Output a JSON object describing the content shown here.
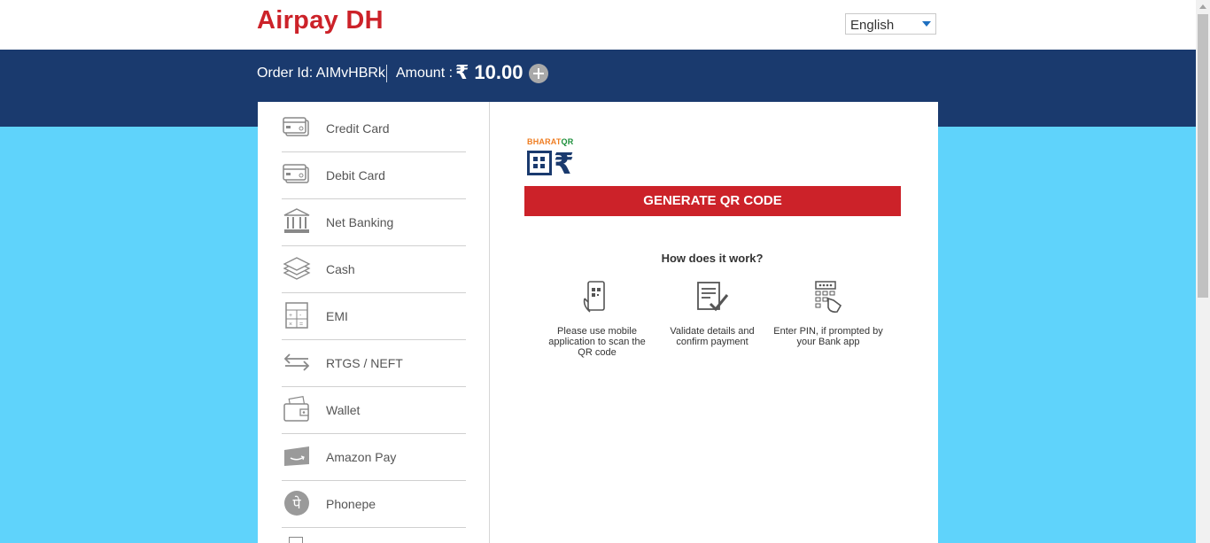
{
  "header": {
    "brand": "Airpay DH",
    "language": {
      "selected": "English"
    }
  },
  "order": {
    "order_id_text": "Order Id: AIMvHBRk",
    "amount_label": "Amount :",
    "amount_value": "₹ 10.00"
  },
  "sidebar": {
    "items": [
      {
        "label": "Credit Card",
        "icon": "credit-card-icon"
      },
      {
        "label": "Debit Card",
        "icon": "debit-card-icon"
      },
      {
        "label": "Net Banking",
        "icon": "bank-icon"
      },
      {
        "label": "Cash",
        "icon": "cash-icon"
      },
      {
        "label": "EMI",
        "icon": "calculator-icon"
      },
      {
        "label": "RTGS / NEFT",
        "icon": "transfer-arrows-icon"
      },
      {
        "label": "Wallet",
        "icon": "wallet-icon"
      },
      {
        "label": "Amazon Pay",
        "icon": "amazon-pay-icon"
      },
      {
        "label": "Phonepe",
        "icon": "phonepe-icon"
      }
    ]
  },
  "main": {
    "bharatqr": {
      "word_part1": "BHARAT",
      "word_part2": "QR"
    },
    "generate_button": "GENERATE QR CODE",
    "how_title": "How does it work?",
    "steps": [
      {
        "text": "Please use mobile application to scan the QR code",
        "icon": "phone-scan-icon"
      },
      {
        "text": "Validate details and confirm payment",
        "icon": "document-check-icon"
      },
      {
        "text": "Enter PIN, if prompted by your Bank app",
        "icon": "keypad-pin-icon"
      }
    ]
  },
  "colors": {
    "brand_red": "#cc2229",
    "nav_blue": "#1a3a6e",
    "page_bg": "#5fd3fb"
  }
}
